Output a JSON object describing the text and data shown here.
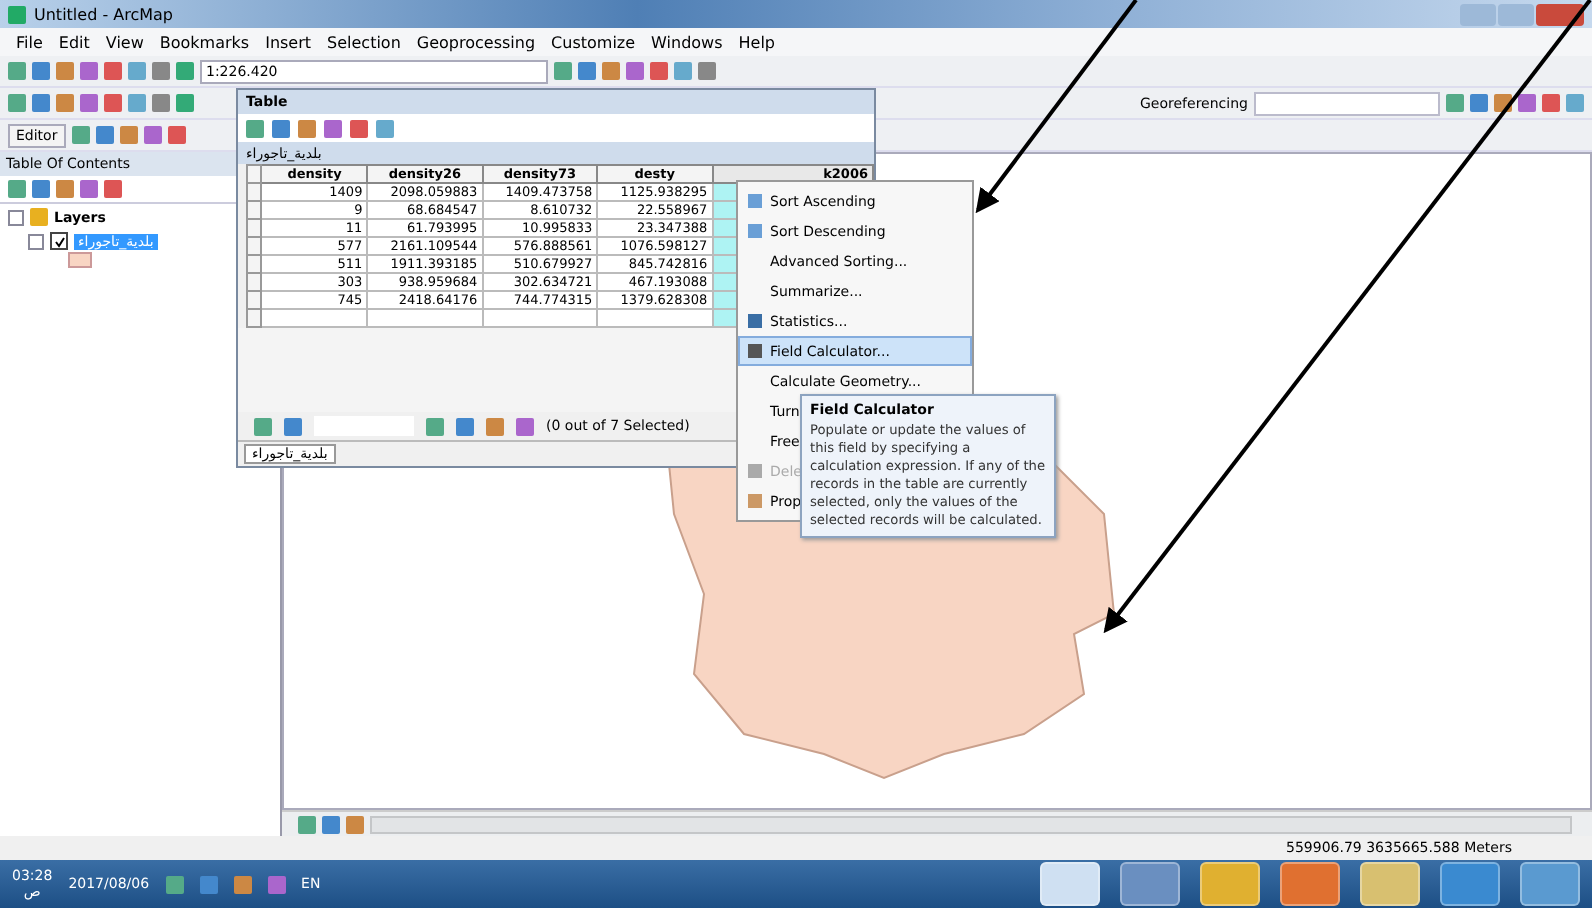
{
  "window": {
    "title": "Untitled - ArcMap"
  },
  "menu": [
    "File",
    "Edit",
    "View",
    "Bookmarks",
    "Insert",
    "Selection",
    "Geoprocessing",
    "Customize",
    "Windows",
    "Help"
  ],
  "scale": {
    "value": "1:226.420"
  },
  "editor": {
    "label": "Editor"
  },
  "georeferencing": {
    "label": "Georeferencing"
  },
  "toc": {
    "title": "Table Of Contents",
    "root": {
      "label": "Layers",
      "expanded": true,
      "children": [
        {
          "label": "بلدية_تاجوراء",
          "checked": true,
          "selected": true
        }
      ]
    }
  },
  "table": {
    "title": "Table",
    "layer_title": "بلدية_تاجوراء",
    "columns": [
      {
        "label": "density",
        "selected": false
      },
      {
        "label": "density26",
        "selected": false
      },
      {
        "label": "density73",
        "selected": false
      },
      {
        "label": "desty",
        "selected": false
      },
      {
        "label": "k2006",
        "selected": true
      }
    ],
    "rows": [
      [
        "1409",
        "2098.059883",
        "1409.473758",
        "1125.938295",
        ""
      ],
      [
        "9",
        "68.684547",
        "8.610732",
        "22.558967",
        ""
      ],
      [
        "11",
        "61.793995",
        "10.995833",
        "23.347388",
        ""
      ],
      [
        "577",
        "2161.109544",
        "576.888561",
        "1076.598127",
        ""
      ],
      [
        "511",
        "1911.393185",
        "510.679927",
        "845.742816",
        ""
      ],
      [
        "303",
        "938.959684",
        "302.634721",
        "467.193088",
        ""
      ],
      [
        "745",
        "2418.64176",
        "744.774315",
        "1379.628308",
        ""
      ]
    ],
    "selection_status": "(0 out of 7 Selected)",
    "tab": "بلدية_تاجوراء"
  },
  "context_menu": [
    {
      "label": "Sort Ascending",
      "selected": false,
      "disabled": false
    },
    {
      "label": "Sort Descending",
      "selected": false,
      "disabled": false
    },
    {
      "label": "Advanced Sorting...",
      "selected": false,
      "disabled": false
    },
    {
      "label": "Summarize...",
      "selected": false,
      "disabled": false
    },
    {
      "label": "Statistics...",
      "selected": false,
      "disabled": false
    },
    {
      "label": "Field Calculator...",
      "selected": true,
      "disabled": false
    },
    {
      "label": "Calculate Geometry...",
      "selected": false,
      "disabled": false
    },
    {
      "label": "Turn",
      "selected": false,
      "disabled": false
    },
    {
      "label": "Free",
      "selected": false,
      "disabled": false
    },
    {
      "label": "Dele",
      "selected": false,
      "disabled": true
    },
    {
      "label": "Prop",
      "selected": false,
      "disabled": false
    }
  ],
  "tooltip": {
    "title": "Field Calculator",
    "text": "Populate or update the values of this field by specifying a calculation expression. If any of the records in the table are currently selected, only the values of the selected records will be calculated."
  },
  "status_bar": {
    "coordinates": "559906.79  3635665.588 Meters"
  },
  "taskbar": {
    "time": "03:28",
    "period": "ص",
    "date": "2017/08/06",
    "language": "EN"
  }
}
